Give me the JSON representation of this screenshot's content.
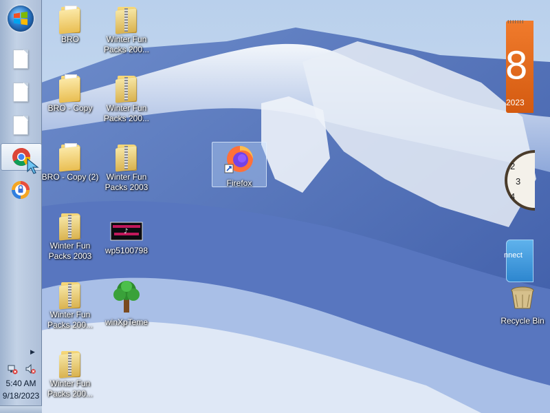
{
  "taskbar": {
    "start_label": "Start",
    "pinned": [
      {
        "name": "document-1"
      },
      {
        "name": "document-2"
      },
      {
        "name": "document-3"
      },
      {
        "name": "chrome"
      },
      {
        "name": "secure-browser"
      }
    ],
    "tray": {
      "time": "5:40 AM",
      "date": "9/18/2023"
    }
  },
  "desktop": {
    "icons": [
      {
        "label": "BRO",
        "type": "folder"
      },
      {
        "label": "Winter Fun Packs 200...",
        "type": "zip"
      },
      {
        "label": "BRO - Copy",
        "type": "folder"
      },
      {
        "label": "Winter Fun Packs 200...",
        "type": "zip"
      },
      {
        "label": "BRO - Copy (2)",
        "type": "folder"
      },
      {
        "label": "Winter Fun Packs 2003",
        "type": "zip"
      },
      {
        "label": "Winter Fun Packs 2003",
        "type": "zip"
      },
      {
        "label": "wp5100798",
        "type": "image"
      },
      {
        "label": "Winter Fun Packs 200...",
        "type": "zip"
      },
      {
        "label": "winXpTeme",
        "type": "tree"
      },
      {
        "label": "Winter Fun Packs 200...",
        "type": "zip"
      },
      {
        "label": "Firefox",
        "type": "shortcut"
      },
      {
        "label": "Recycle Bin",
        "type": "recycle"
      }
    ]
  },
  "gadgets": {
    "calendar": {
      "day_partial": "8",
      "year": "2023"
    },
    "clock": {
      "visible_numbers": [
        "2",
        "3",
        "4"
      ]
    },
    "connect": {
      "label": "nnect"
    }
  }
}
